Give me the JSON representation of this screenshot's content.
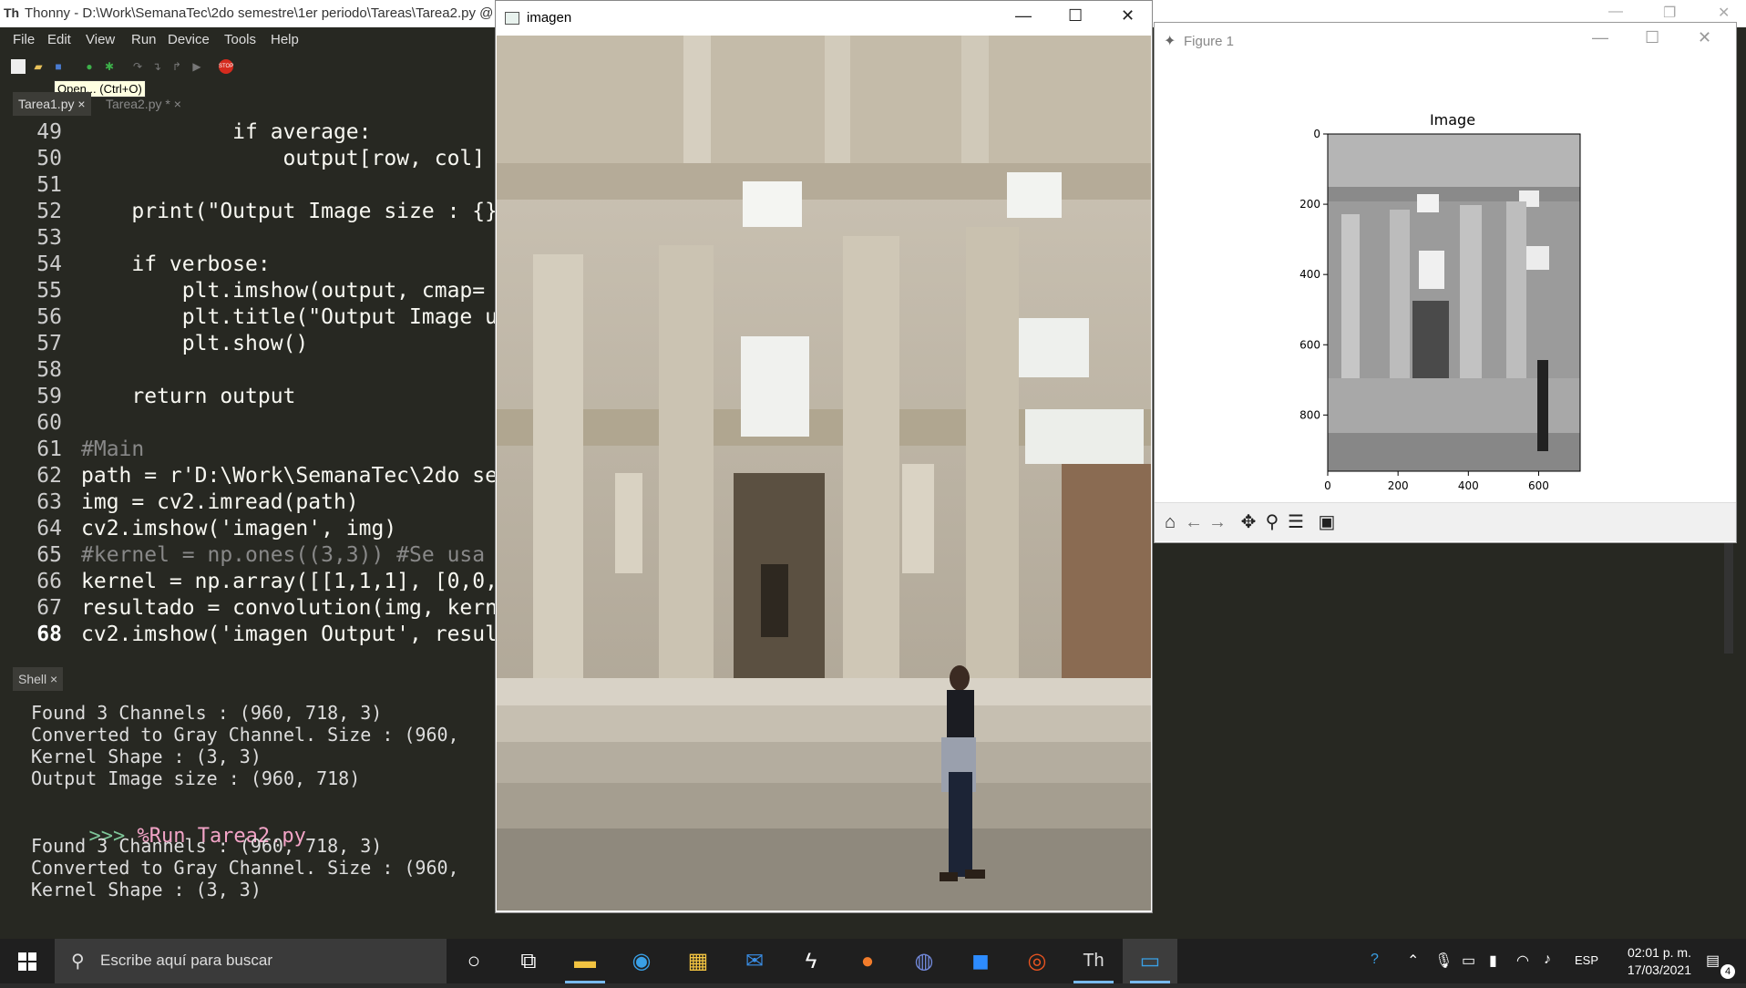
{
  "thonny": {
    "title": "Thonny  -  D:\\Work\\SemanaTec\\2do semestre\\1er periodo\\Tareas\\Tarea2.py  @",
    "menu": [
      "File",
      "Edit",
      "View",
      "Run",
      "Device",
      "Tools",
      "Help"
    ],
    "tooltip": "Open... (Ctrl+O)",
    "tabs": [
      {
        "label": "Tarea1.py ×"
      },
      {
        "label": "Tarea2.py * ×"
      }
    ],
    "editor_lines": [
      {
        "n": "49",
        "code": "            if average:"
      },
      {
        "n": "50",
        "code": "                output[row, col]"
      },
      {
        "n": "51",
        "code": ""
      },
      {
        "n": "52",
        "code": "    print(\"Output Image size : {}"
      },
      {
        "n": "53",
        "code": ""
      },
      {
        "n": "54",
        "code": "    if verbose:"
      },
      {
        "n": "55",
        "code": "        plt.imshow(output, cmap="
      },
      {
        "n": "56",
        "code": "        plt.title(\"Output Image u"
      },
      {
        "n": "57",
        "code": "        plt.show()"
      },
      {
        "n": "58",
        "code": ""
      },
      {
        "n": "59",
        "code": "    return output"
      },
      {
        "n": "60",
        "code": ""
      },
      {
        "n": "61",
        "code": "#Main"
      },
      {
        "n": "62",
        "code": "path = r'D:\\Work\\SemanaTec\\2do se"
      },
      {
        "n": "63",
        "code": "img = cv2.imread(path)"
      },
      {
        "n": "64",
        "code": "cv2.imshow('imagen', img)"
      },
      {
        "n": "65",
        "code": "#kernel = np.ones((3,3)) #Se usa"
      },
      {
        "n": "66",
        "code": "kernel = np.array([[1,1,1], [0,0,"
      },
      {
        "n": "67",
        "code": "resultado = convolution(img, kern"
      },
      {
        "n": "68",
        "code": "cv2.imshow('imagen Output', resul"
      }
    ],
    "shell_tab": "Shell ×",
    "shell_lines": [
      "Found 3 Channels : (960, 718, 3)",
      "Converted to Gray Channel. Size : (960,",
      "Kernel Shape : (3, 3)",
      "Output Image size : (960, 718)"
    ],
    "shell_prompt": ">>> ",
    "shell_cmd": "%Run Tarea2.py",
    "shell_lines2": [
      "Found 3 Channels : (960, 718, 3)",
      "Converted to Gray Channel. Size : (960,",
      "Kernel Shape : (3, 3)"
    ]
  },
  "imagen_window": {
    "title": "imagen"
  },
  "figure_window": {
    "title": "Figure 1",
    "chart_data": {
      "type": "image",
      "title": "Image",
      "x_ticks": [
        "0",
        "200",
        "400",
        "600"
      ],
      "y_ticks": [
        "0",
        "200",
        "400",
        "600",
        "800"
      ],
      "xlim": [
        0,
        718
      ],
      "ylim": [
        960,
        0
      ]
    },
    "toolbar_icons": [
      "home-icon",
      "back-icon",
      "forward-icon",
      "pan-icon",
      "zoom-icon",
      "configure-icon",
      "save-icon"
    ]
  },
  "taskbar": {
    "search_placeholder": "Escribe aquí para buscar",
    "apps": [
      "task-view",
      "explorer",
      "edge",
      "store",
      "mail",
      "terminal",
      "firefox",
      "discord",
      "zoom",
      "ubuntu",
      "thonny",
      "python-window"
    ],
    "lang": "ESP",
    "time": "02:01 p. m.",
    "date": "17/03/2021",
    "notification_count": "4"
  }
}
